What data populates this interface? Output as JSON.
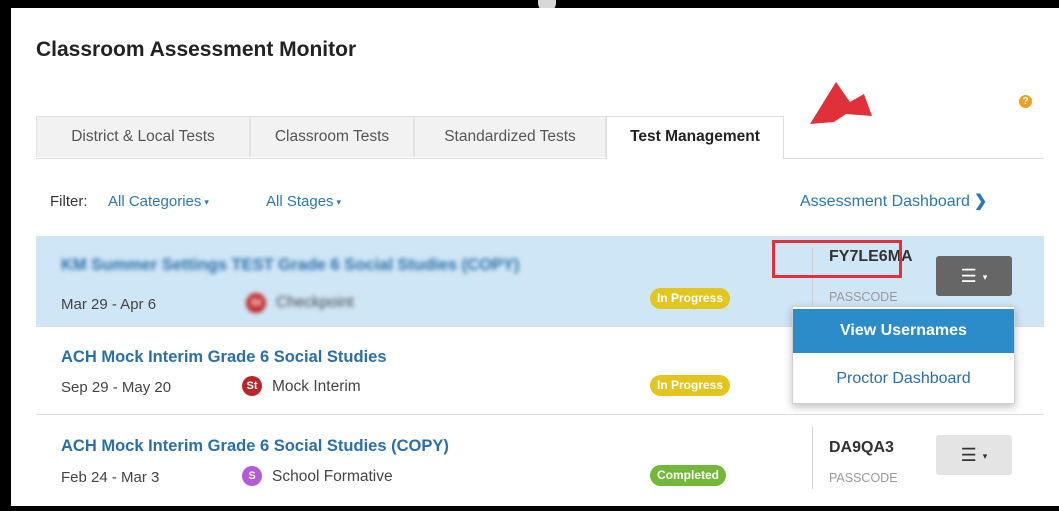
{
  "app": {
    "title": "Classroom Assessment Monitor"
  },
  "help_icon_glyph": "?",
  "tabs": [
    {
      "label": "District & Local Tests",
      "active": false
    },
    {
      "label": "Classroom Tests",
      "active": false
    },
    {
      "label": "Standardized Tests",
      "active": false
    },
    {
      "label": "Test Management",
      "active": true
    }
  ],
  "filter": {
    "label": "Filter:",
    "categories": "All Categories",
    "stages": "All Stages",
    "caret": "▾"
  },
  "dashboard_link": {
    "label": "Assessment Dashboard",
    "chevron": "❯"
  },
  "rows": [
    {
      "title": "KM Summer Settings TEST Grade 6 Social Studies (COPY)",
      "dates": "Mar 29 - Apr 6",
      "badge": "St",
      "badge_color": "#c0282d",
      "category": "Checkpoint",
      "status": "In Progress",
      "passcode": "FY7LE6MA",
      "passcode_label": "PASSCODE",
      "selected": true,
      "blurred": true
    },
    {
      "title": "ACH Mock Interim Grade 6 Social Studies",
      "dates": "Sep 29 - May 20",
      "badge": "St",
      "badge_color": "#b8262b",
      "category": "Mock Interim",
      "status": "In Progress",
      "passcode": "",
      "passcode_label": "",
      "selected": false,
      "blurred": false
    },
    {
      "title": "ACH Mock Interim Grade 6 Social Studies (COPY)",
      "dates": "Feb 24 - Mar 3",
      "badge": "S",
      "badge_color": "#b35ad8",
      "category": "School Formative",
      "status": "Completed",
      "passcode": "DA9QA3",
      "passcode_label": "PASSCODE",
      "selected": false,
      "blurred": false
    }
  ],
  "menu_button_glyph": "☰",
  "menu_caret": "▾",
  "dropdown": {
    "items": [
      "View Usernames",
      "Proctor Dashboard"
    ],
    "highlighted_index": 0
  },
  "colors": {
    "accent": "#2a78b4",
    "selected_row": "#cfe6f6",
    "in_progress": "#e3c520",
    "completed": "#74b83a",
    "highlight_box": "#e0313a",
    "annotation_arrow": "#e0313a"
  }
}
